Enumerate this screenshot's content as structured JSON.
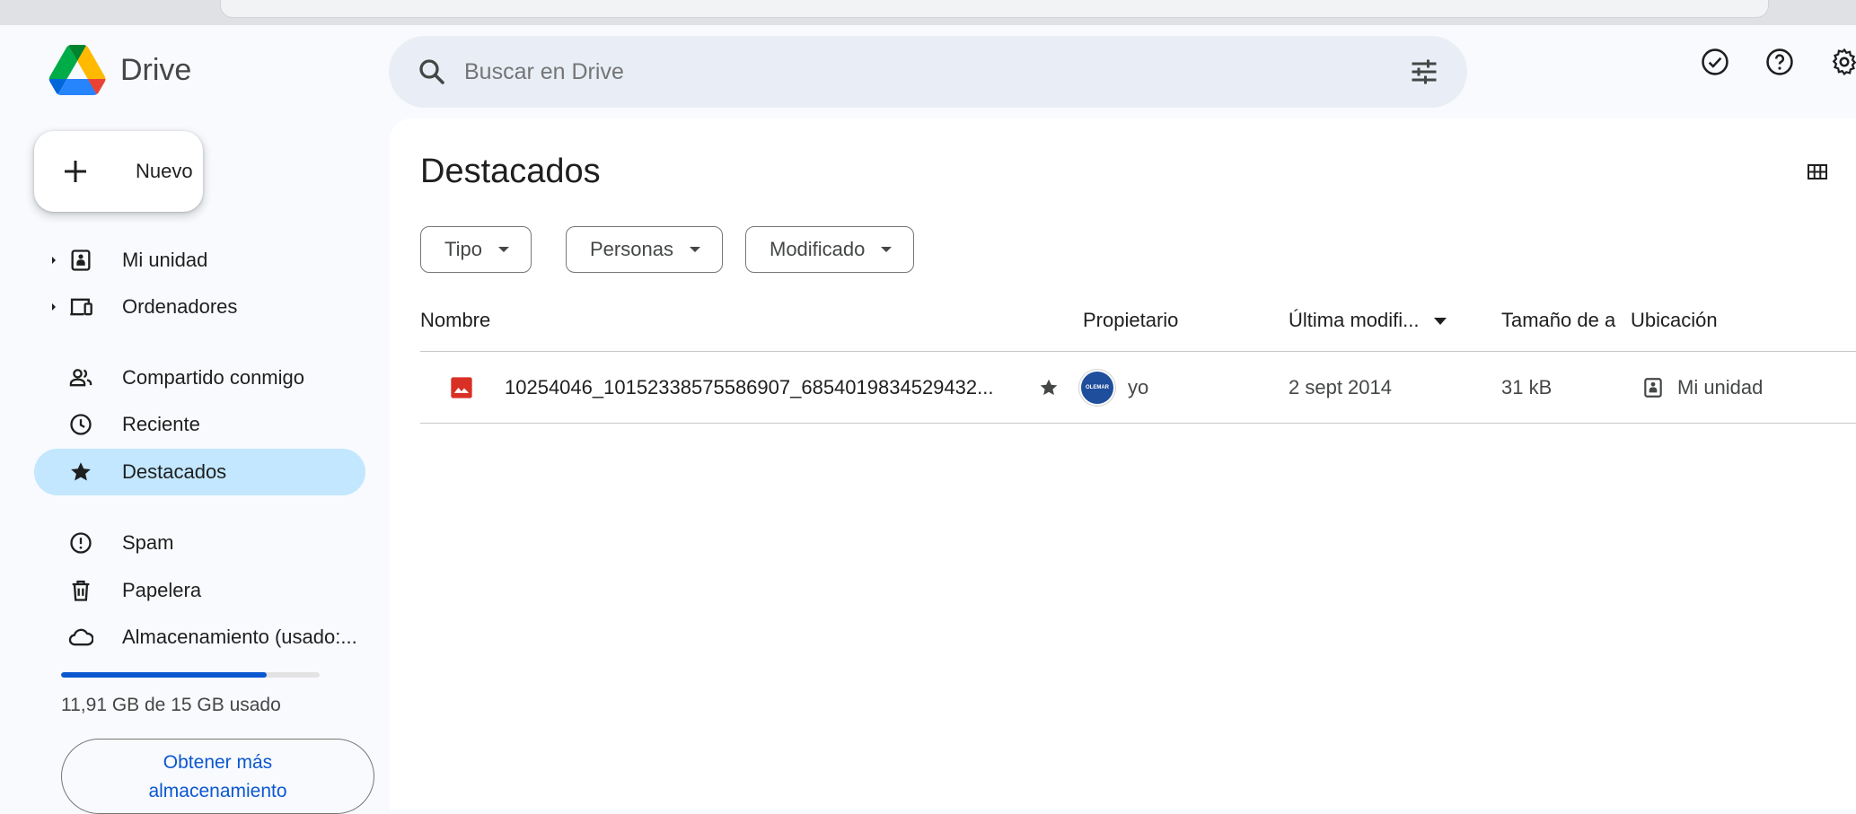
{
  "app": {
    "name": "Drive"
  },
  "search": {
    "placeholder": "Buscar en Drive"
  },
  "sidebar": {
    "new_label": "Nuevo",
    "items": [
      {
        "label": "Mi unidad",
        "icon": "drive-icon",
        "expandable": true
      },
      {
        "label": "Ordenadores",
        "icon": "computers-icon",
        "expandable": true
      },
      {
        "label": "Compartido conmigo",
        "icon": "people-icon"
      },
      {
        "label": "Reciente",
        "icon": "clock-icon"
      },
      {
        "label": "Destacados",
        "icon": "star-icon",
        "active": true
      },
      {
        "label": "Spam",
        "icon": "spam-icon"
      },
      {
        "label": "Papelera",
        "icon": "trash-icon"
      },
      {
        "label": "Almacenamiento (usado:...",
        "icon": "cloud-icon"
      }
    ],
    "storage": {
      "used_fraction": 0.794,
      "text": "11,91 GB de 15 GB usado",
      "button_label_line1": "Obtener más",
      "button_label_line2": "almacenamiento"
    }
  },
  "main": {
    "title": "Destacados",
    "filters": [
      "Tipo",
      "Personas",
      "Modificado"
    ],
    "columns": {
      "name": "Nombre",
      "owner": "Propietario",
      "modified": "Última modifi...",
      "size": "Tamaño de a",
      "location": "Ubicación"
    },
    "rows": [
      {
        "name": "10254046_10152338575586907_6854019834529432...",
        "owner": "yo",
        "avatar_text": "OLEMAR",
        "modified": "2 sept 2014",
        "size": "31 kB",
        "location": "Mi unidad"
      }
    ]
  },
  "colors": {
    "accent": "#0b57d0",
    "active_nav": "#c2e7ff",
    "image_icon": "#d93025"
  }
}
